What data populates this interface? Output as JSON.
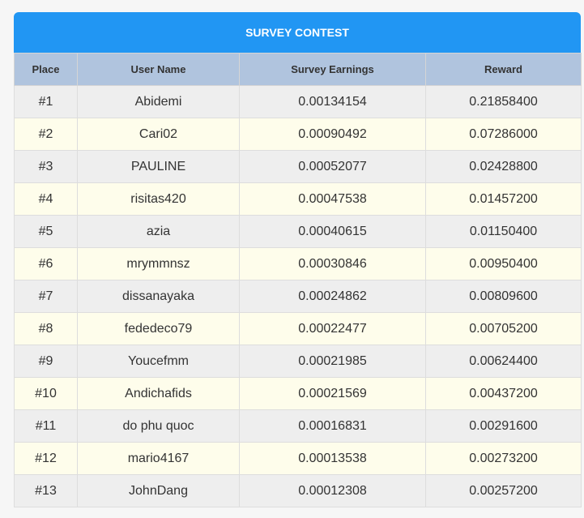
{
  "title": "SURVEY CONTEST",
  "columns": {
    "place": "Place",
    "user": "User Name",
    "earnings": "Survey Earnings",
    "reward": "Reward"
  },
  "rows": [
    {
      "place": "#1",
      "user": "Abidemi",
      "earnings": "0.00134154",
      "reward": "0.21858400"
    },
    {
      "place": "#2",
      "user": "Cari02",
      "earnings": "0.00090492",
      "reward": "0.07286000"
    },
    {
      "place": "#3",
      "user": "PAULINE",
      "earnings": "0.00052077",
      "reward": "0.02428800"
    },
    {
      "place": "#4",
      "user": "risitas420",
      "earnings": "0.00047538",
      "reward": "0.01457200"
    },
    {
      "place": "#5",
      "user": "azia",
      "earnings": "0.00040615",
      "reward": "0.01150400"
    },
    {
      "place": "#6",
      "user": "mrymmnsz",
      "earnings": "0.00030846",
      "reward": "0.00950400"
    },
    {
      "place": "#7",
      "user": "dissanayaka",
      "earnings": "0.00024862",
      "reward": "0.00809600"
    },
    {
      "place": "#8",
      "user": "fededeco79",
      "earnings": "0.00022477",
      "reward": "0.00705200"
    },
    {
      "place": "#9",
      "user": "Youcefmm",
      "earnings": "0.00021985",
      "reward": "0.00624400"
    },
    {
      "place": "#10",
      "user": "Andichafids",
      "earnings": "0.00021569",
      "reward": "0.00437200"
    },
    {
      "place": "#11",
      "user": "do phu quoc",
      "earnings": "0.00016831",
      "reward": "0.00291600"
    },
    {
      "place": "#12",
      "user": "mario4167",
      "earnings": "0.00013538",
      "reward": "0.00273200"
    },
    {
      "place": "#13",
      "user": "JohnDang",
      "earnings": "0.00012308",
      "reward": "0.00257200"
    }
  ]
}
